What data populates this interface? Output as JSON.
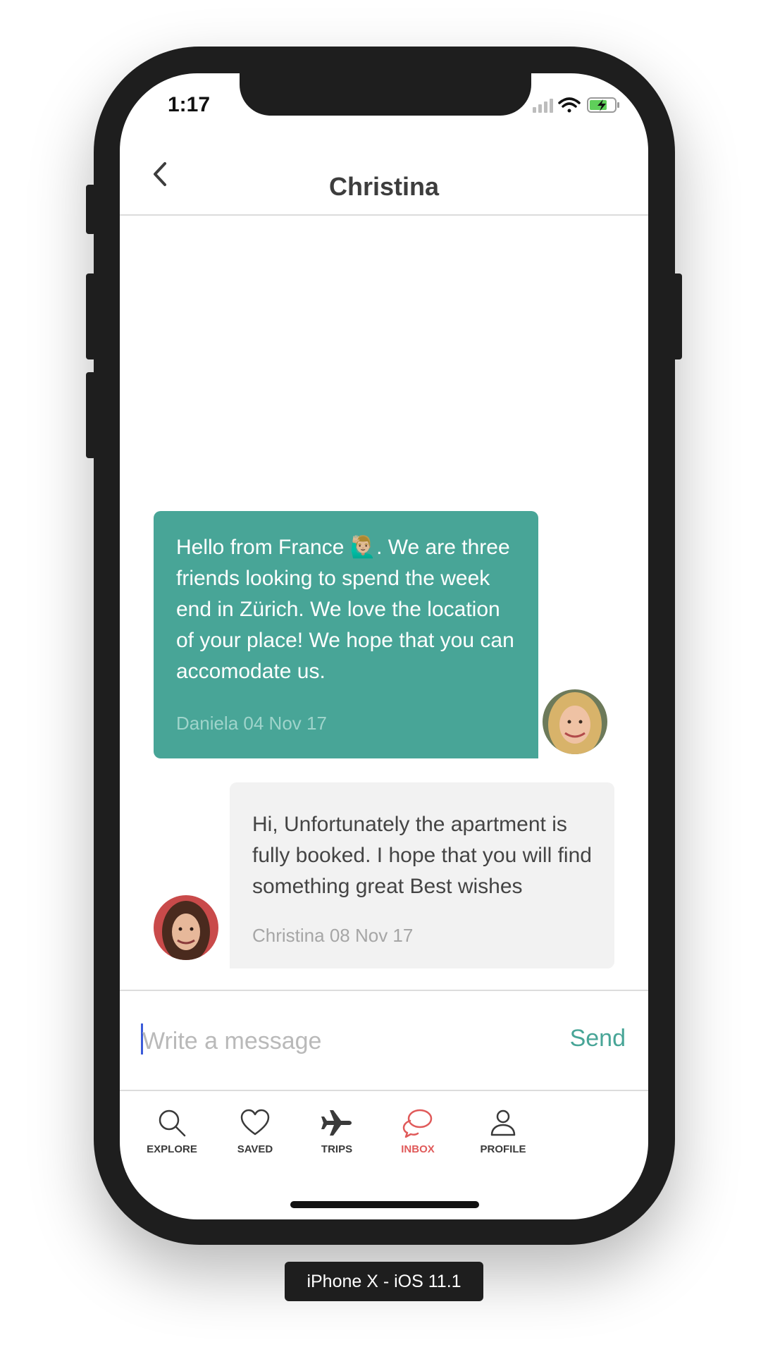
{
  "status_bar": {
    "time": "1:17"
  },
  "header": {
    "title": "Christina"
  },
  "messages": [
    {
      "sender": "Daniela",
      "text": "Hello from France 🙋🏼‍♂️. We are three friends looking to spend the week end in Zürich. We love the location of your place! We hope that you can accomodate us.",
      "meta": "Daniela 04 Nov 17",
      "bubble_color": "#48a597"
    },
    {
      "sender": "Christina",
      "text": "Hi, Unfortunately the apartment is fully booked. I hope that you will find something great Best wishes",
      "meta": "Christina 08 Nov 17",
      "bubble_color": "#f2f2f2"
    }
  ],
  "composer": {
    "placeholder": "Write a message",
    "send_label": "Send"
  },
  "tabs": [
    {
      "label": "EXPLORE",
      "icon": "search-icon"
    },
    {
      "label": "SAVED",
      "icon": "heart-icon"
    },
    {
      "label": "TRIPS",
      "icon": "airplane-icon"
    },
    {
      "label": "INBOX",
      "icon": "chat-bubbles-icon",
      "active": true
    },
    {
      "label": "PROFILE",
      "icon": "person-icon"
    }
  ],
  "device_label": "iPhone X - iOS 11.1",
  "colors": {
    "accent": "#48a597",
    "active_tab": "#e05a5a"
  }
}
